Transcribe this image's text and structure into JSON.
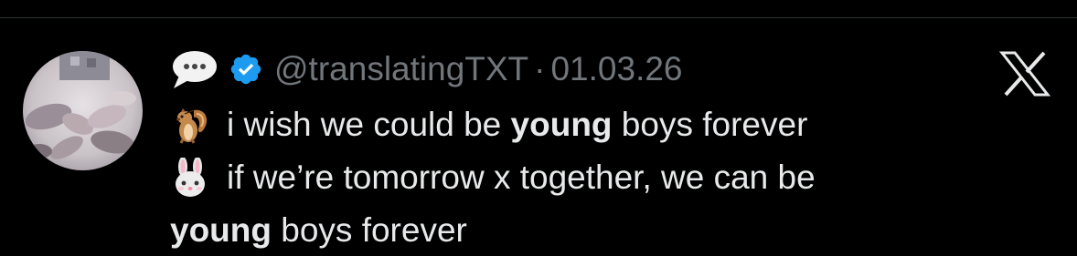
{
  "tweet": {
    "handle": "@translatingTXT",
    "separator": "·",
    "date": "01.03.26",
    "lines": [
      {
        "emoji": "chipmunk-emoji",
        "before": "i wish we could be ",
        "bold": "young",
        "after": " boys forever"
      },
      {
        "emoji": "rabbit-face-emoji",
        "text": "if we’re tomorrow x together, we can be"
      },
      {
        "bold": "young",
        "after": " boys forever"
      }
    ]
  },
  "icons": {
    "speech_bubble": "speech-bubble-icon",
    "verified": "verified-badge-icon",
    "platform": "x-logo-icon"
  },
  "colors": {
    "background": "#000000",
    "text": "#e7e9ea",
    "secondary_text": "#71767b",
    "verified_blue": "#1d9bf0",
    "divider": "#2f3336"
  }
}
